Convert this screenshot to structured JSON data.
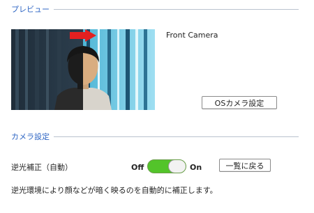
{
  "preview_section": {
    "title": "プレビュー",
    "camera_name": "Front Camera",
    "os_camera_settings_label": "OSカメラ設定"
  },
  "camera_settings_section": {
    "title": "カメラ設定",
    "backlight": {
      "label": "逆光補正（自動）",
      "off_label": "Off",
      "on_label": "On",
      "state": "on",
      "reset_label": "一覧に戻る",
      "description": "逆光環境により顔などが暗く映るのを自動的に補正します。"
    }
  },
  "colors": {
    "accent_blue": "#2f66c4",
    "toggle_green": "#53c42a",
    "arrow_red": "#e32020"
  },
  "icons": [
    "red-arrow-right-icon",
    "person-silhouette-icon"
  ]
}
